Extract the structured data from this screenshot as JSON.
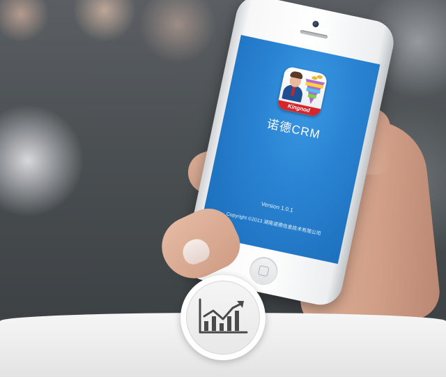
{
  "app": {
    "icon_banner": "Kingnod",
    "name": "诺德CRM",
    "version_text": "Version 1.0.1",
    "copyright_text": "Copyright ©2013 湖南诺德信息技术有限公司"
  },
  "badge": {
    "icon": "chart-trend-icon"
  },
  "colors": {
    "screen_blue": "#2a84d3",
    "icon_banner_red": "#d6262b",
    "badge_icon_gray": "#4a4a4a"
  }
}
